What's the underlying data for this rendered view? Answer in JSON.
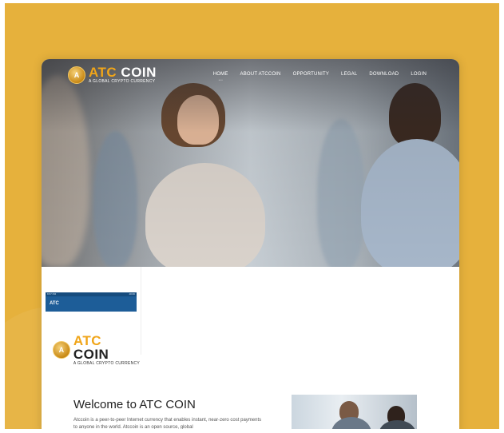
{
  "brand": {
    "name_part1": "ATC",
    "name_part2": "COIN",
    "tagline": "A GLOBAL CRYPTO CURRENCY",
    "coin_glyph": "A"
  },
  "nav": {
    "items": [
      {
        "label": "HOME",
        "active": true
      },
      {
        "label": "ABOUT ATCCOIN"
      },
      {
        "label": "OPPORTUNITY"
      },
      {
        "label": "LEGAL"
      },
      {
        "label": "DOWNLOAD"
      },
      {
        "label": "LOGIN"
      }
    ]
  },
  "phone": {
    "status_left": "8:57 PM",
    "status_right": "48.80",
    "app_title": "ATC"
  },
  "welcome": {
    "title": "Welcome to ATC COIN",
    "text": "Atccoin is a peer-to-peer Internet currency that enables instant, near-zero cost payments to anyone in the world. Atccoin is an open source, global"
  },
  "colors": {
    "background": "#e6b13c",
    "accent": "#f0a519",
    "appbar": "#1d5d98"
  }
}
